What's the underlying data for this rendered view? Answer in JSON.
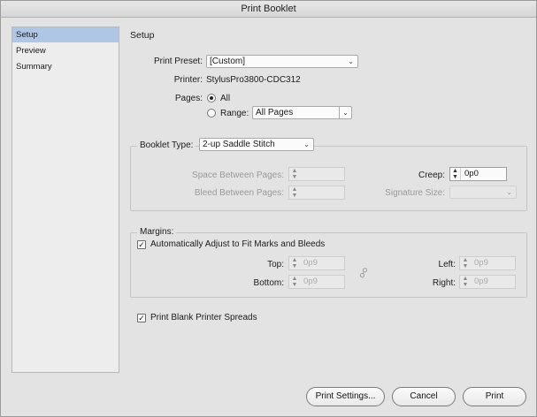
{
  "window": {
    "title": "Print Booklet"
  },
  "sidebar": {
    "items": [
      {
        "label": "Setup",
        "selected": true
      },
      {
        "label": "Preview",
        "selected": false
      },
      {
        "label": "Summary",
        "selected": false
      }
    ]
  },
  "section_title": "Setup",
  "print_preset": {
    "label": "Print Preset:",
    "value": "[Custom]"
  },
  "printer": {
    "label": "Printer:",
    "value": "StylusPro3800-CDC312"
  },
  "pages": {
    "label": "Pages:",
    "all_label": "All",
    "all_selected": true,
    "range_label": "Range:",
    "range_value": "All Pages"
  },
  "booklet": {
    "type_label": "Booklet Type:",
    "type_value": "2-up Saddle Stitch",
    "space_between_label": "Space Between Pages:",
    "space_between_value": "",
    "bleed_between_label": "Bleed Between Pages:",
    "bleed_between_value": "",
    "creep_label": "Creep:",
    "creep_value": "0p0",
    "signature_label": "Signature Size:",
    "signature_value": ""
  },
  "margins": {
    "group_label": "Margins:",
    "auto_adjust_label": "Automatically Adjust to Fit Marks and Bleeds",
    "auto_adjust_checked": true,
    "top_label": "Top:",
    "top_value": "0p9",
    "bottom_label": "Bottom:",
    "bottom_value": "0p9",
    "left_label": "Left:",
    "left_value": "0p9",
    "right_label": "Right:",
    "right_value": "0p9"
  },
  "blank_spreads": {
    "label": "Print Blank Printer Spreads",
    "checked": true
  },
  "buttons": {
    "print_settings": "Print Settings...",
    "cancel": "Cancel",
    "print": "Print"
  },
  "icons": {
    "chevron": "chevron-down-icon",
    "check": "checkmark-icon",
    "stepper": "stepper-arrows-icon",
    "link": "chain-link-icon"
  }
}
